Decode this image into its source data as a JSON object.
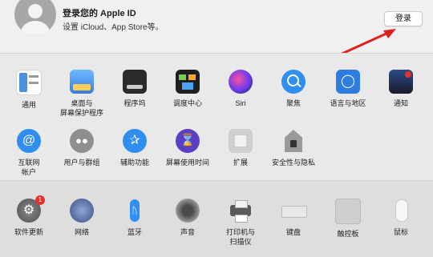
{
  "account": {
    "title": "登录您的 Apple ID",
    "subtitle": "设置 iCloud、App Store等。",
    "login_label": "登录"
  },
  "row1": [
    {
      "label": "通用",
      "icon": "general-icon"
    },
    {
      "label": "桌面与\n屏幕保护程序",
      "icon": "desktop-screensaver-icon"
    },
    {
      "label": "程序坞",
      "icon": "dock-icon"
    },
    {
      "label": "调度中心",
      "icon": "mission-control-icon"
    },
    {
      "label": "Siri",
      "icon": "siri-icon"
    },
    {
      "label": "聚焦",
      "icon": "spotlight-icon"
    },
    {
      "label": "语言与地区",
      "icon": "language-region-icon"
    },
    {
      "label": "通知",
      "icon": "notifications-icon"
    }
  ],
  "row2": [
    {
      "label": "互联网\n帐户",
      "icon": "internet-accounts-icon"
    },
    {
      "label": "用户与群组",
      "icon": "users-groups-icon"
    },
    {
      "label": "辅助功能",
      "icon": "accessibility-icon"
    },
    {
      "label": "屏幕使用时间",
      "icon": "screen-time-icon"
    },
    {
      "label": "扩展",
      "icon": "extensions-icon"
    },
    {
      "label": "安全性与隐私",
      "icon": "security-privacy-icon"
    }
  ],
  "row3": [
    {
      "label": "软件更新",
      "icon": "software-update-icon",
      "badge": "1"
    },
    {
      "label": "网络",
      "icon": "network-icon"
    },
    {
      "label": "蓝牙",
      "icon": "bluetooth-icon"
    },
    {
      "label": "声音",
      "icon": "sound-icon"
    },
    {
      "label": "打印机与\n扫描仪",
      "icon": "printers-scanners-icon"
    },
    {
      "label": "键盘",
      "icon": "keyboard-icon"
    },
    {
      "label": "触控板",
      "icon": "trackpad-icon"
    },
    {
      "label": "鼠标",
      "icon": "mouse-icon"
    }
  ],
  "colors": {
    "accent_arrow": "#e02020",
    "badge": "#e5312d"
  }
}
